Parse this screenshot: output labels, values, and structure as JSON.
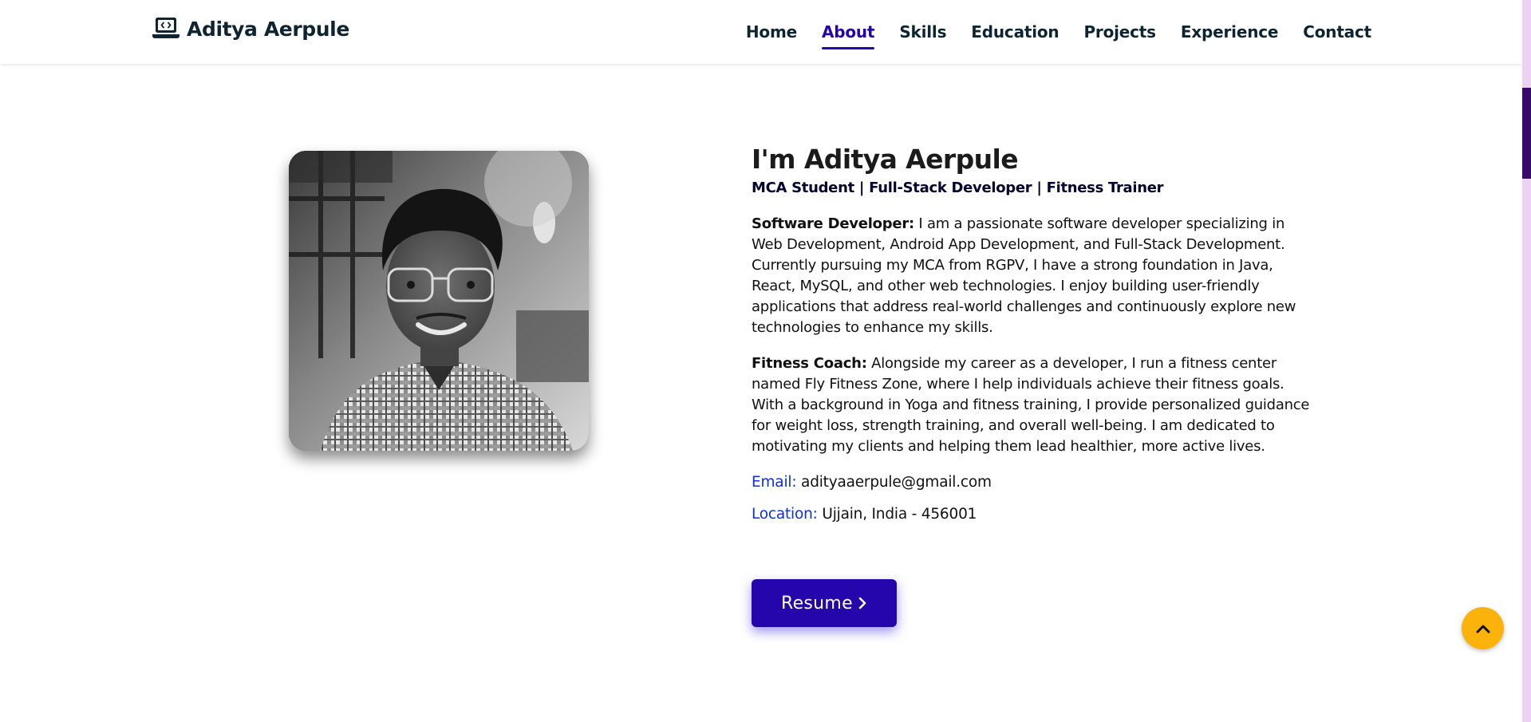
{
  "brand": {
    "name": "Aditya Aerpule",
    "icon": "laptop-code-icon"
  },
  "nav": {
    "items": [
      {
        "label": "Home",
        "active": false
      },
      {
        "label": "About",
        "active": true
      },
      {
        "label": "Skills",
        "active": false
      },
      {
        "label": "Education",
        "active": false
      },
      {
        "label": "Projects",
        "active": false
      },
      {
        "label": "Experience",
        "active": false
      },
      {
        "label": "Contact",
        "active": false
      }
    ],
    "active_color": "#2506ad"
  },
  "about": {
    "title": "I'm Aditya Aerpule",
    "subtitle": "MCA Student | Full-Stack Developer | Fitness Trainer",
    "software_label": "Software Developer:",
    "software_text": " I am a passionate software developer specializing in Web Development, Android App Development, and Full-Stack Development. Currently pursuing my MCA from RGPV, I have a strong foundation in Java, React, MySQL, and other web technologies. I enjoy building user-friendly applications that address real-world challenges and continuously explore new technologies to enhance my skills.",
    "fitness_label": "Fitness Coach:",
    "fitness_text": " Alongside my career as a developer, I run a fitness center named Fly Fitness Zone, where I help individuals achieve their fitness goals. With a background in Yoga and fitness training, I provide personalized guidance for weight loss, strength training, and overall well-being. I am dedicated to motivating my clients and helping them lead healthier, more active lives.",
    "email_label": "Email:",
    "email_value": " adityaaerpule@gmail.com",
    "location_label": "Location:",
    "location_value": " Ujjain, India - 456001",
    "resume_label": "Resume",
    "photo_icon": "profile-photo"
  },
  "colors": {
    "accent": "#2506ad",
    "link_label": "#0e2fe0",
    "scroll_top_bg": "#fbb30b"
  },
  "scroll_top_icon": "chevron-up-icon"
}
